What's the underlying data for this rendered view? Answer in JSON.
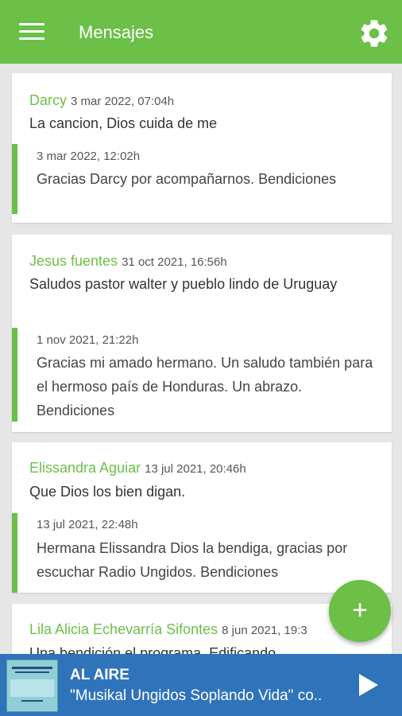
{
  "header": {
    "title": "Mensajes",
    "menu_icon": "menu-icon",
    "settings_icon": "gear-icon"
  },
  "messages": [
    {
      "author": "Darcy",
      "date": "3 mar 2022, 07:04h",
      "text": "La cancion, Dios cuida de me",
      "reply": {
        "date": "3 mar 2022, 12:02h",
        "text": "Gracias Darcy por acompañarnos. Bendiciones"
      }
    },
    {
      "author": "Jesus fuentes",
      "date": "31 oct 2021, 16:56h",
      "text": "Saludos pastor walter y pueblo lindo de Uruguay",
      "reply": {
        "date": "1 nov 2021, 21:22h",
        "text": "Gracias mi amado hermano. Un saludo también para el hermoso país de Honduras. Un abrazo. Bendiciones"
      }
    },
    {
      "author": "Elissandra Aguiar",
      "date": "13 jul 2021, 20:46h",
      "text": "Que Dios los bien digan.",
      "reply": {
        "date": "13 jul 2021, 22:48h",
        "text": "Hermana Elissandra Dios la bendiga,  gracias por escuchar Radio Ungidos. Bendiciones"
      }
    },
    {
      "author": "Lila Alicia Echevarría Sifontes",
      "date": "8 jun 2021, 19:3",
      "text": "Una bendición el programa. Edificando"
    }
  ],
  "fab": {
    "icon": "plus-icon",
    "label": "+"
  },
  "player": {
    "status": "AL AIRE",
    "now_playing": "\"Musikal Ungidos Soplando Vida\" co..",
    "play_icon": "play-icon",
    "cover_icon": "album-cover-icon"
  },
  "colors": {
    "primary": "#6cbf47",
    "player_bg": "#2f73bb"
  }
}
